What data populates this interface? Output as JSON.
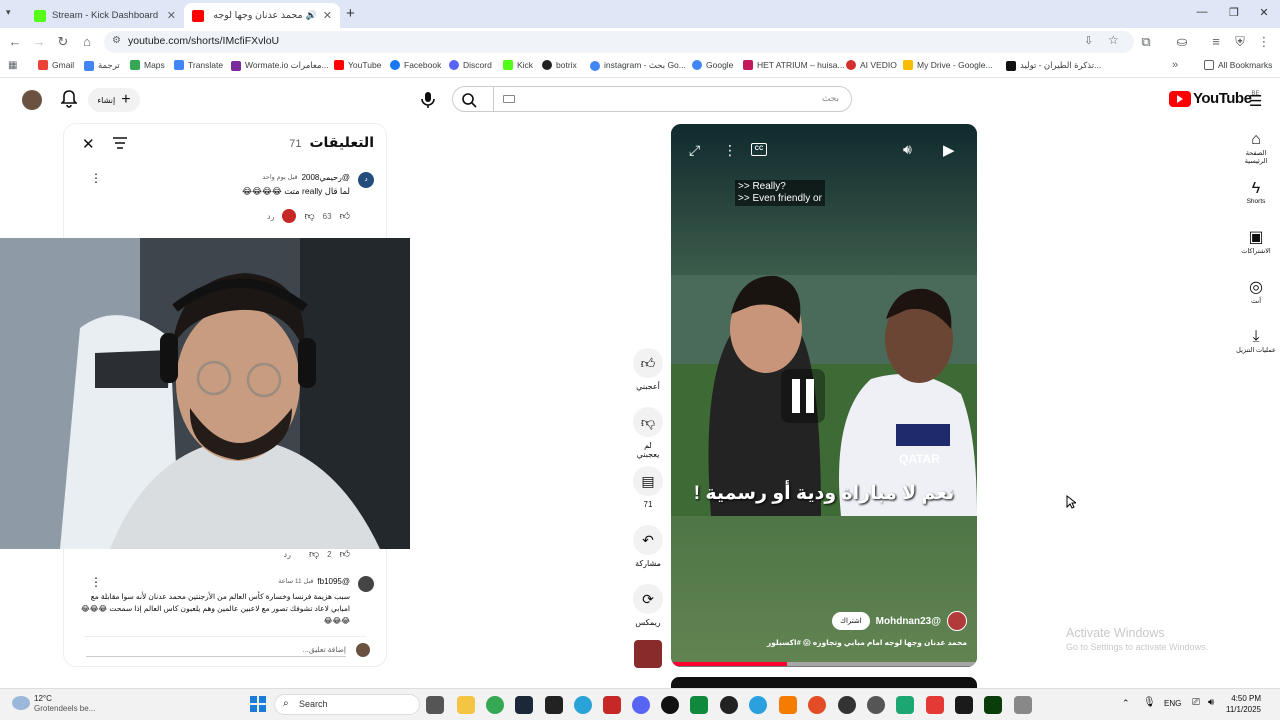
{
  "browser": {
    "tabs": [
      {
        "label": "Stream - Kick Dashboard",
        "active": false,
        "favicon_color": "#53fc18"
      },
      {
        "label": "محمد عدنان وجها لوجه امام",
        "active": true,
        "favicon_color": "#ff0000"
      }
    ],
    "new_tab": "+",
    "url": "youtube.com/shorts/IMcfiFXvloU",
    "window_controls": [
      "minimize",
      "maximize",
      "close"
    ]
  },
  "bookmarks": [
    {
      "label": "Gmail",
      "color": "#ea4335"
    },
    {
      "label": "ترجمة",
      "color": "#4285f4"
    },
    {
      "label": "Maps",
      "color": "#34a853"
    },
    {
      "label": "Translate",
      "color": "#4285f4"
    },
    {
      "label": "Wormate.io معامرات...",
      "color": "#7b2a9b"
    },
    {
      "label": "YouTube",
      "color": "#ff0000"
    },
    {
      "label": "Facebook",
      "color": "#1877f2"
    },
    {
      "label": "Discord",
      "color": "#5865f2"
    },
    {
      "label": "Kick",
      "color": "#53fc18"
    },
    {
      "label": "botrix",
      "color": "#222222"
    },
    {
      "label": "instagram - بحث Go...",
      "color": "#4285f4"
    },
    {
      "label": "Google",
      "color": "#4285f4"
    },
    {
      "label": "HET ATRIUM – huisa...",
      "color": "#c2185b"
    },
    {
      "label": "AI VEDIO",
      "color": "#d32f2f"
    },
    {
      "label": "My Drive - Google...",
      "color": "#fbbc04"
    },
    {
      "label": "تذكرة الطيران - توليد...",
      "color": "#111111"
    }
  ],
  "all_bookmarks": "All Bookmarks",
  "youtube": {
    "logo": "YouTube",
    "region": "BE",
    "search_placeholder": "بحث",
    "create_label": "إنشاء",
    "sidebar": [
      {
        "label": "الصفحة الرئيسية",
        "icon": "home-icon"
      },
      {
        "label": "Shorts",
        "icon": "shorts-icon"
      },
      {
        "label": "الاشتراكات",
        "icon": "subscriptions-icon"
      },
      {
        "label": "أنت",
        "icon": "you-icon"
      },
      {
        "label": "عمليات التنزيل",
        "icon": "download-icon"
      }
    ]
  },
  "comments": {
    "title": "التعليقات",
    "count": "71",
    "items": [
      {
        "author": "@رحيمي2008",
        "time": "قبل يوم واحد",
        "text": "لما قال really متت 😂😂😂😂",
        "likes": "63",
        "reply": "رد"
      },
      {
        "author": "",
        "time": "",
        "text": "",
        "likes": "2",
        "reply": "رد"
      },
      {
        "author": "@fb1095",
        "time": "قبل 11 ساعة",
        "text": "سبب هزيمة فرنسا وخسارة كأس العالم من الأرجنتين محمد عدنان لأنه سوا مقابلة مع امبابي لاعاد تشوفك تصور مع لاعبين عالمين وهم يلعبون كاس العالم إذا سمحت 😂😂😂😂😂😂",
        "likes": "",
        "reply": ""
      }
    ],
    "add_placeholder": "إضافة تعليق..."
  },
  "short": {
    "subtitle_lines": [
      ">> Really?",
      ">> Even friendly or"
    ],
    "caption": "نعم لا مباراة ودية أو رسمية !",
    "channel": "@Mohdnan23",
    "subscribe": "اشتراك",
    "video_title": "محمد عدنان وجها لوجه امام مبابي وتجاوزه 😱 #اكسبلور",
    "kit_text": "QATAR",
    "progress": 0.38
  },
  "actions": [
    {
      "label": "أعجبني",
      "icon": "like-icon"
    },
    {
      "label": "لم يعجبني",
      "icon": "dislike-icon"
    },
    {
      "label": "71",
      "icon": "comment-icon"
    },
    {
      "label": "مشاركة",
      "icon": "share-icon"
    },
    {
      "label": "ريمكس",
      "icon": "remix-icon"
    }
  ],
  "watermark": {
    "title": "Activate Windows",
    "sub": "Go to Settings to activate Windows."
  },
  "taskbar": {
    "weather_temp": "12°C",
    "weather_desc": "Grotendeels be...",
    "search": "Search",
    "lang": "ENG",
    "time": "4:50 PM",
    "date": "11/1/2025"
  }
}
